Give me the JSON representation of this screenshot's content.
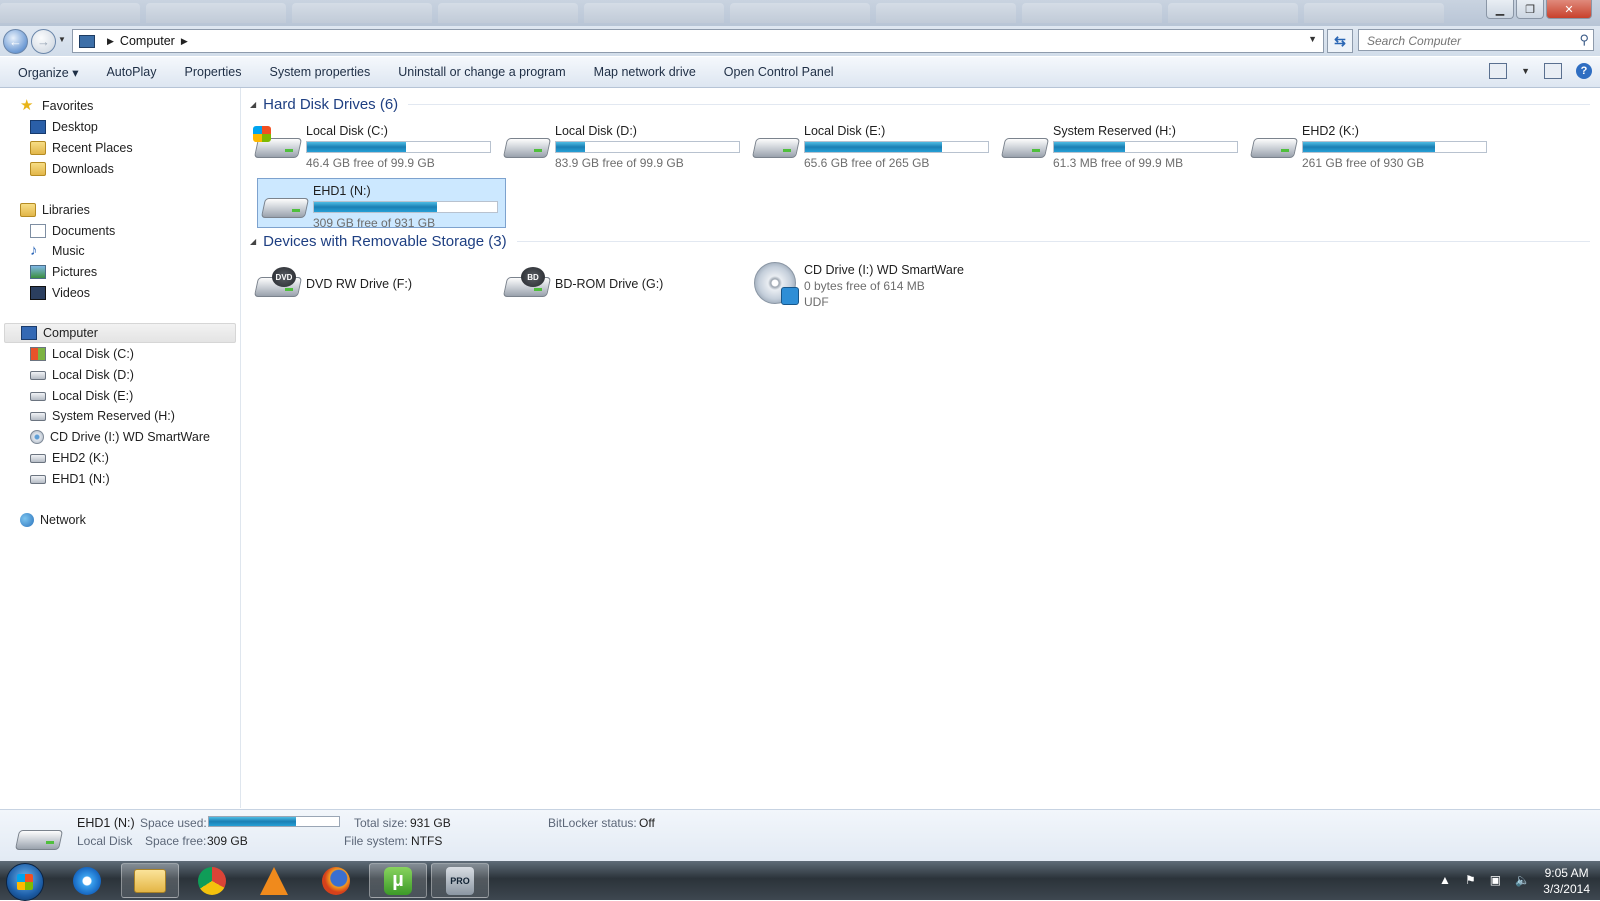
{
  "window": {
    "controls": [
      "minimize",
      "restore",
      "close"
    ]
  },
  "address": {
    "crumbs": [
      "Computer"
    ],
    "search_placeholder": "Search Computer"
  },
  "toolbar": {
    "organize": "Organize ▾",
    "autoplay": "AutoPlay",
    "properties": "Properties",
    "system_properties": "System properties",
    "uninstall": "Uninstall or change a program",
    "map_drive": "Map network drive",
    "control_panel": "Open Control Panel"
  },
  "nav": {
    "favorites": {
      "label": "Favorites",
      "items": [
        {
          "label": "Desktop",
          "icon": "desktop-icon"
        },
        {
          "label": "Recent Places",
          "icon": "recent-places-icon"
        },
        {
          "label": "Downloads",
          "icon": "downloads-icon"
        }
      ]
    },
    "libraries": {
      "label": "Libraries",
      "items": [
        {
          "label": "Documents",
          "icon": "documents-icon"
        },
        {
          "label": "Music",
          "icon": "music-icon"
        },
        {
          "label": "Pictures",
          "icon": "pictures-icon"
        },
        {
          "label": "Videos",
          "icon": "videos-icon"
        }
      ]
    },
    "computer": {
      "label": "Computer",
      "items": [
        {
          "label": "Local Disk (C:)",
          "icon": "system-drive-icon"
        },
        {
          "label": "Local Disk (D:)",
          "icon": "drive-icon"
        },
        {
          "label": "Local Disk (E:)",
          "icon": "drive-icon"
        },
        {
          "label": "System Reserved (H:)",
          "icon": "drive-icon"
        },
        {
          "label": "CD Drive (I:) WD SmartWare",
          "icon": "cd-drive-icon"
        },
        {
          "label": "EHD2 (K:)",
          "icon": "drive-icon"
        },
        {
          "label": "EHD1 (N:)",
          "icon": "drive-icon"
        }
      ]
    },
    "network": {
      "label": "Network"
    }
  },
  "groups": {
    "hard_disks": {
      "title": "Hard Disk Drives (6)",
      "drives": [
        {
          "name": "Local Disk (C:)",
          "free": "46.4 GB free of 99.9 GB",
          "used_fraction": 0.54,
          "system": true
        },
        {
          "name": "Local Disk (D:)",
          "free": "83.9 GB free of 99.9 GB",
          "used_fraction": 0.16
        },
        {
          "name": "Local Disk (E:)",
          "free": "65.6 GB free of 265 GB",
          "used_fraction": 0.75
        },
        {
          "name": "System Reserved (H:)",
          "free": "61.3 MB free of 99.9 MB",
          "used_fraction": 0.39
        },
        {
          "name": "EHD2 (K:)",
          "free": "261 GB free of 930 GB",
          "used_fraction": 0.72
        },
        {
          "name": "EHD1 (N:)",
          "free": "309 GB free of 931 GB",
          "used_fraction": 0.67,
          "selected": true
        }
      ]
    },
    "removable": {
      "title": "Devices with Removable Storage (3)",
      "devices": [
        {
          "name": "DVD RW Drive (F:)",
          "badge": "DVD"
        },
        {
          "name": "BD-ROM Drive (G:)",
          "badge": "BD"
        },
        {
          "name": "CD Drive (I:) WD SmartWare",
          "line2": "0 bytes free of 614 MB",
          "line3": "UDF"
        }
      ]
    }
  },
  "details": {
    "name": "EHD1 (N:)",
    "type": "Local Disk",
    "space_used_label": "Space used:",
    "space_used_fraction": 0.67,
    "space_free_label": "Space free:",
    "space_free": "309 GB",
    "total_size_label": "Total size:",
    "total_size": "931 GB",
    "file_system_label": "File system:",
    "file_system": "NTFS",
    "bitlocker_label": "BitLocker status:",
    "bitlocker": "Off"
  },
  "taskbar": {
    "apps": [
      {
        "icon": "internet-explorer-icon"
      },
      {
        "icon": "windows-explorer-icon",
        "open": true
      },
      {
        "icon": "chrome-icon"
      },
      {
        "icon": "vlc-icon"
      },
      {
        "icon": "firefox-icon"
      },
      {
        "icon": "utorrent-icon",
        "open": true,
        "glyph": "µ"
      },
      {
        "icon": "pro-dvd-icon",
        "open": true,
        "glyph": "PRO"
      }
    ],
    "time": "9:05 AM",
    "date": "3/3/2014"
  },
  "colors": {
    "accent": "#1e3f82",
    "bar_fill": "#26a0d6",
    "selection": "#cce8ff"
  }
}
